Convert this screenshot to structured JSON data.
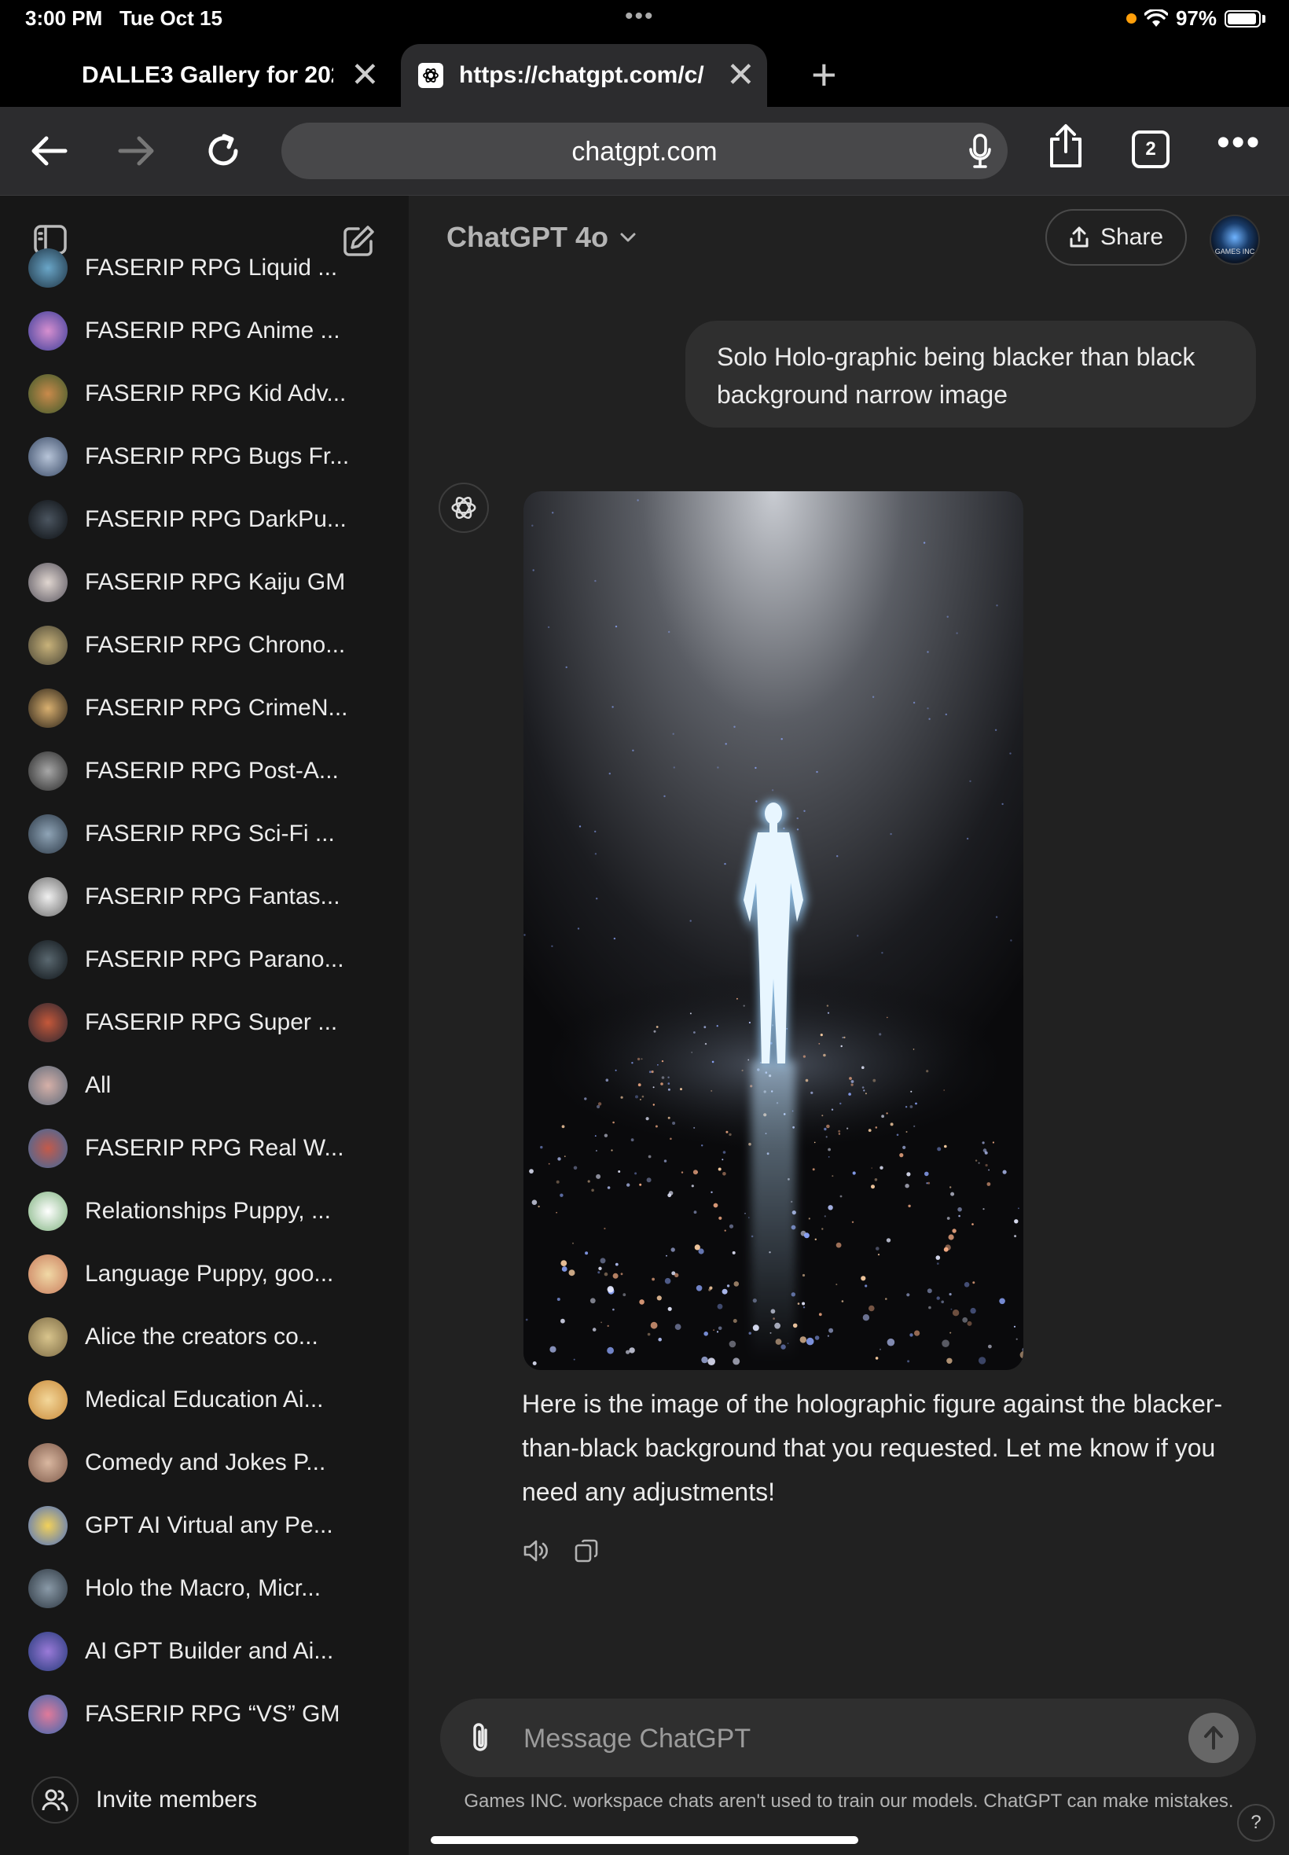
{
  "status_bar": {
    "time": "3:00 PM",
    "date": "Tue Oct 15",
    "battery": "97%"
  },
  "browser": {
    "tabs": [
      {
        "title": "DALLE3 Gallery for 202",
        "active": false
      },
      {
        "title": "https://chatgpt.com/c/",
        "active": true
      }
    ],
    "url": "chatgpt.com",
    "tab_count": "2"
  },
  "sidebar": {
    "chats": [
      {
        "label": "FASERIP RPG Liquid ..."
      },
      {
        "label": "FASERIP RPG Anime ..."
      },
      {
        "label": "FASERIP RPG Kid Adv..."
      },
      {
        "label": "FASERIP RPG Bugs Fr..."
      },
      {
        "label": "FASERIP RPG DarkPu..."
      },
      {
        "label": "FASERIP RPG Kaiju GM"
      },
      {
        "label": "FASERIP RPG Chrono..."
      },
      {
        "label": "FASERIP RPG CrimeN..."
      },
      {
        "label": "FASERIP RPG Post-A..."
      },
      {
        "label": "FASERIP RPG Sci-Fi ..."
      },
      {
        "label": "FASERIP RPG Fantas..."
      },
      {
        "label": "FASERIP RPG Parano..."
      },
      {
        "label": "FASERIP RPG Super ..."
      },
      {
        "label": "All"
      },
      {
        "label": "FASERIP RPG Real W..."
      },
      {
        "label": "Relationships Puppy, ..."
      },
      {
        "label": "Language Puppy, goo..."
      },
      {
        "label": "Alice the creators co..."
      },
      {
        "label": "Medical Education Ai..."
      },
      {
        "label": "Comedy and Jokes P..."
      },
      {
        "label": "GPT AI Virtual any Pe..."
      },
      {
        "label": "Holo the Macro, Micr..."
      },
      {
        "label": "AI GPT Builder and Ai..."
      },
      {
        "label": "FASERIP RPG “VS” GM"
      }
    ],
    "invite_label": "Invite members"
  },
  "header": {
    "model": "ChatGPT 4o",
    "share_label": "Share",
    "avatar_text": "GAMES INC"
  },
  "conversation": {
    "user_message": "Solo Holo-graphic being blacker than black background narrow image",
    "assistant_reply": "Here is the image of the holographic figure against the blacker-than-black background that you requested. Let me know if you need any adjustments!"
  },
  "composer": {
    "placeholder": "Message ChatGPT",
    "disclaimer": "Games INC. workspace chats aren't used to train our models. ChatGPT can make mistakes.",
    "help": "?"
  },
  "colors": {
    "accent": "#ffffff",
    "background": "#212121",
    "sidebar": "#171717",
    "bubble": "#2f2f2f"
  },
  "icons": [
    "sidebar-toggle-icon",
    "new-chat-icon",
    "back-icon",
    "forward-icon",
    "reload-icon",
    "mic-icon",
    "share-icon",
    "more-icon",
    "openai-logo-icon",
    "speaker-icon",
    "copy-icon",
    "paperclip-icon",
    "arrow-up-icon",
    "users-icon"
  ]
}
